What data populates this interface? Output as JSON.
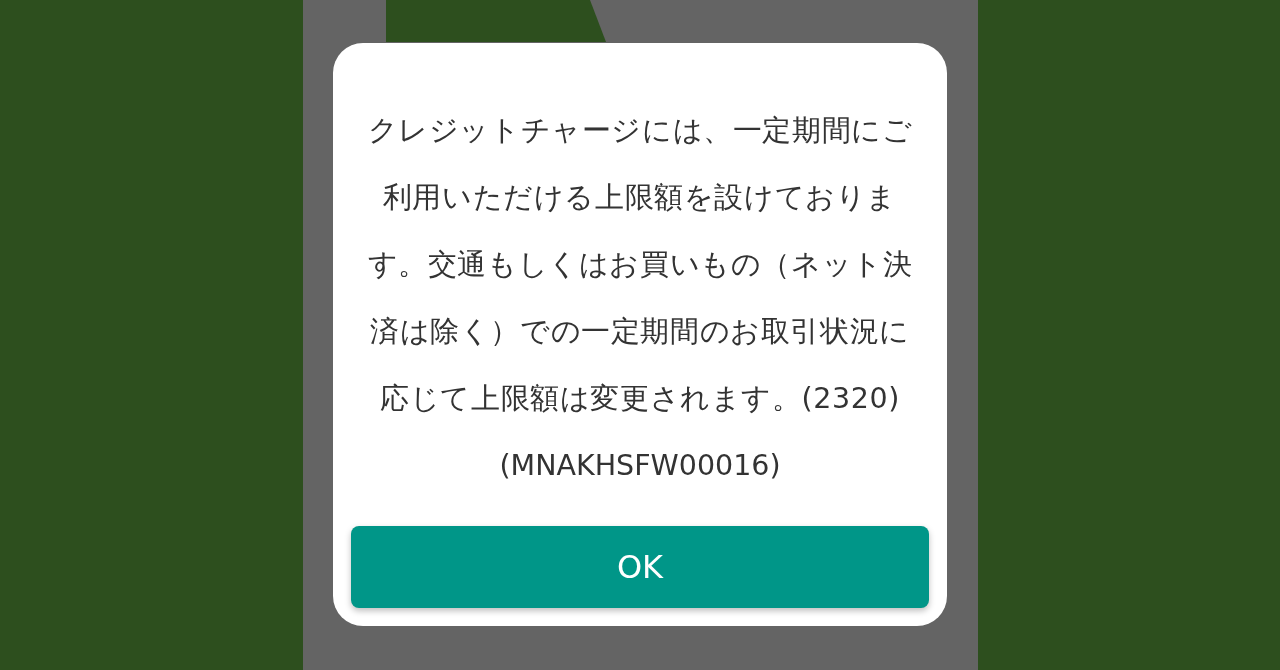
{
  "dialog": {
    "message": "クレジットチャージには、一定期間にご利用いただける上限額を設けております。交通もしくはお買いもの（ネット決済は除く）での一定期間のお取引状況に応じて上限額は変更されます。(2320)",
    "code": "(MNAKHSFW00016)",
    "button": "OK"
  }
}
